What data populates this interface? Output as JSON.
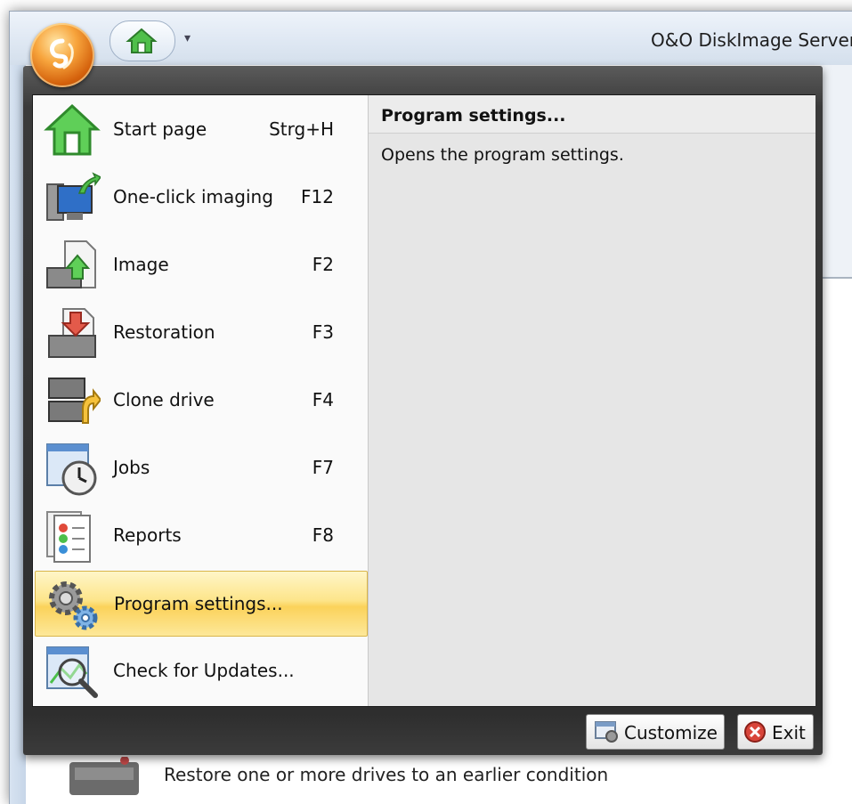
{
  "window": {
    "title": "O&O DiskImage Server"
  },
  "qat": {
    "home_icon": "home-icon",
    "dropdown_glyph": "▾"
  },
  "menu": {
    "items": [
      {
        "label": "Start page",
        "shortcut": "Strg+H",
        "icon": "home-icon"
      },
      {
        "label": "One-click imaging",
        "shortcut": "F12",
        "icon": "one-click-imaging-icon"
      },
      {
        "label": "Image",
        "shortcut": "F2",
        "icon": "image-backup-icon"
      },
      {
        "label": "Restoration",
        "shortcut": "F3",
        "icon": "restoration-icon"
      },
      {
        "label": "Clone drive",
        "shortcut": "F4",
        "icon": "clone-drive-icon"
      },
      {
        "label": "Jobs",
        "shortcut": "F7",
        "icon": "jobs-clock-icon"
      },
      {
        "label": "Reports",
        "shortcut": "F8",
        "icon": "reports-icon"
      },
      {
        "label": "Program settings...",
        "shortcut": "",
        "icon": "gears-icon",
        "selected": true
      },
      {
        "label": "Check for Updates...",
        "shortcut": "",
        "icon": "check-updates-icon"
      }
    ],
    "panel": {
      "title": "Program settings...",
      "description": "Opens the program settings."
    },
    "buttons": {
      "customize": "Customize",
      "exit": "Exit"
    }
  },
  "background": {
    "caption": "Restore one or more drives to an earlier condition"
  },
  "colors": {
    "selected_gradient_top": "#fff6c8",
    "selected_gradient_bottom": "#fbd25a",
    "menu_frame": "#2e2e2e",
    "panel_bg": "#e6e6e6",
    "orb": "#f7a43c"
  }
}
